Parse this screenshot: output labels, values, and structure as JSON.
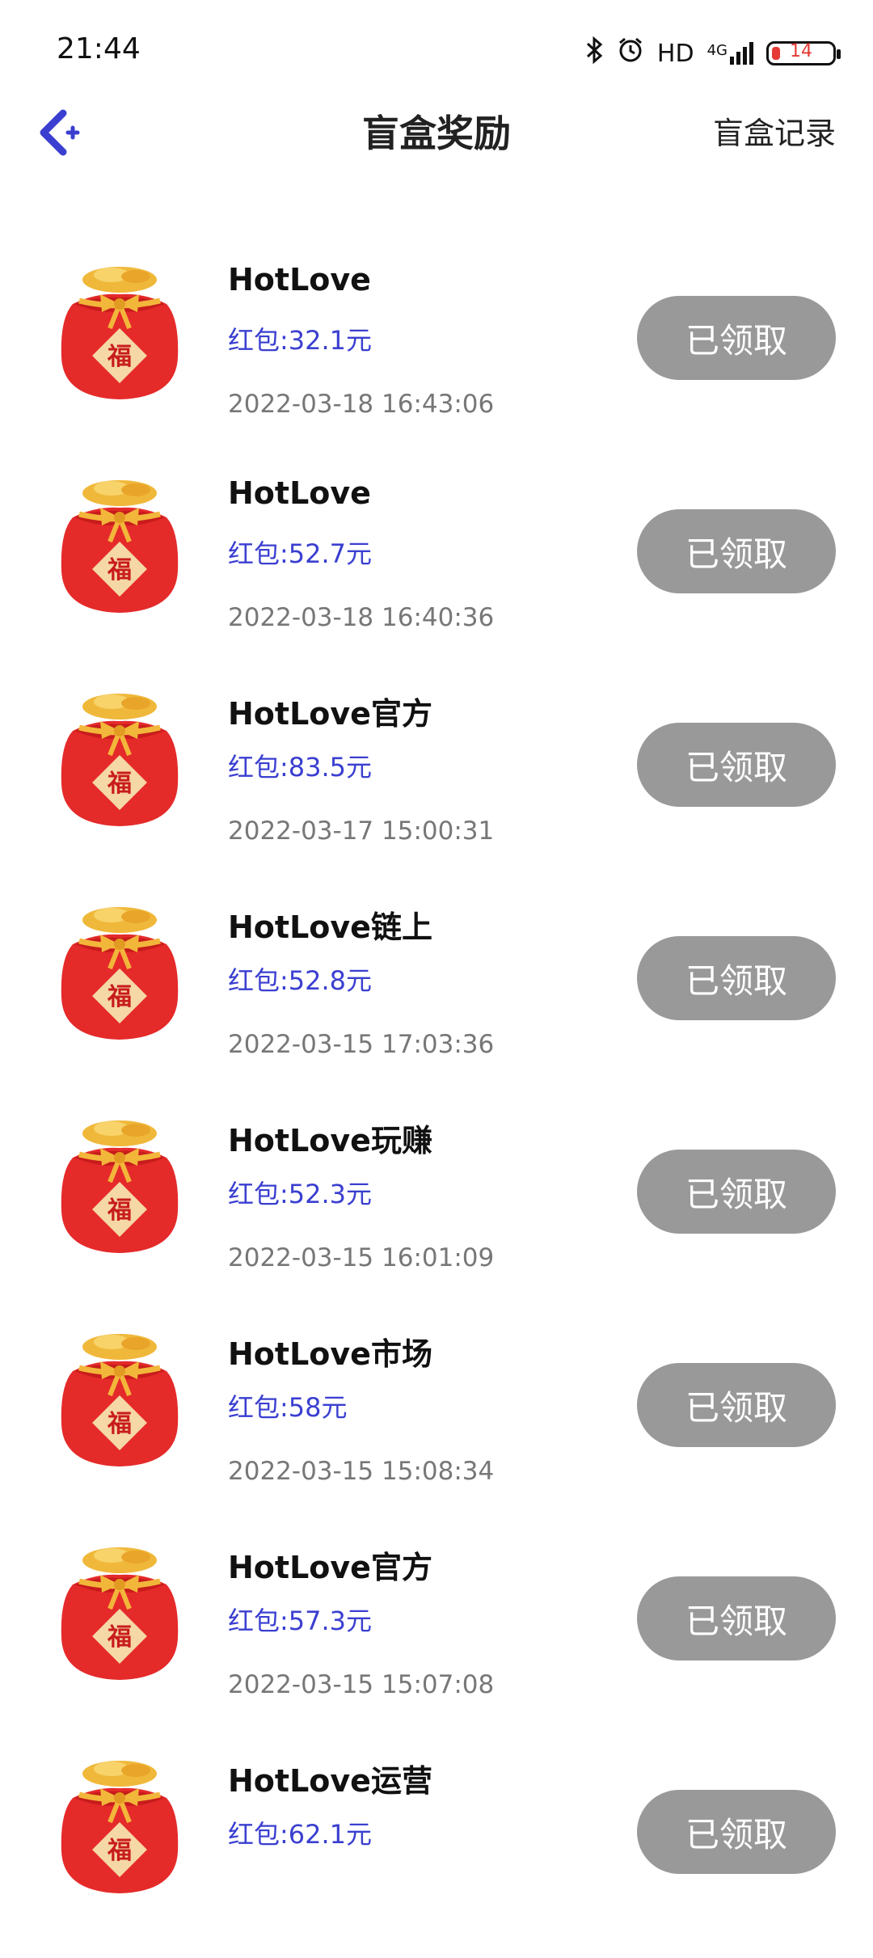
{
  "status": {
    "time": "21:44",
    "hd": "HD",
    "network": "4G",
    "battery": "14",
    "battery_level": 0.14
  },
  "header": {
    "title": "盲盒奖励",
    "records": "盲盒记录"
  },
  "items": [
    {
      "title": "HotLove",
      "amount": "红包:32.1元",
      "time": "2022-03-18 16:43:06",
      "button": "已领取"
    },
    {
      "title": "HotLove",
      "amount": "红包:52.7元",
      "time": "2022-03-18 16:40:36",
      "button": "已领取"
    },
    {
      "title": "HotLove官方",
      "amount": "红包:83.5元",
      "time": "2022-03-17 15:00:31",
      "button": "已领取"
    },
    {
      "title": "HotLove链上",
      "amount": "红包:52.8元",
      "time": "2022-03-15 17:03:36",
      "button": "已领取"
    },
    {
      "title": "HotLove玩赚",
      "amount": "红包:52.3元",
      "time": "2022-03-15 16:01:09",
      "button": "已领取"
    },
    {
      "title": "HotLove市场",
      "amount": "红包:58元",
      "time": "2022-03-15 15:08:34",
      "button": "已领取"
    },
    {
      "title": "HotLove官方",
      "amount": "红包:57.3元",
      "time": "2022-03-15 15:07:08",
      "button": "已领取"
    },
    {
      "title": "HotLove运营",
      "amount": "红包:62.1元",
      "time": "",
      "button": "已领取"
    }
  ],
  "colors": {
    "accent": "#3a3fd0",
    "button_disabled": "#999999"
  },
  "icons": {
    "back": "back-arrow-icon",
    "item": "lucky-bag-icon"
  }
}
